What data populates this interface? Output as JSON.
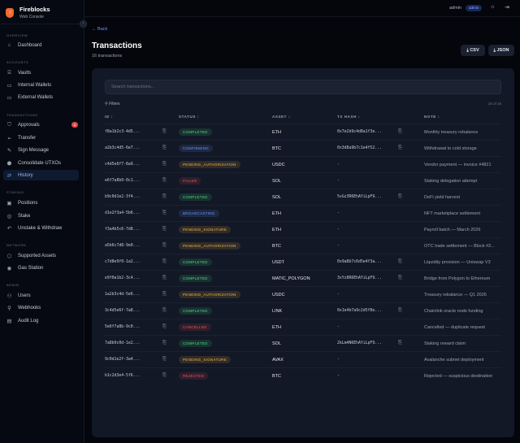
{
  "brand": {
    "name": "Fireblocks",
    "subtitle": "Web Console"
  },
  "sidebar": {
    "sections": [
      {
        "label": "OVERVIEW",
        "items": [
          {
            "label": "Dashboard",
            "icon": "home-icon"
          }
        ]
      },
      {
        "label": "ACCOUNTS",
        "items": [
          {
            "label": "Vaults",
            "icon": "bank-icon"
          },
          {
            "label": "Internal Wallets",
            "icon": "wallet-icon"
          },
          {
            "label": "External Wallets",
            "icon": "wallet-icon"
          }
        ]
      },
      {
        "label": "TRANSACTIONS",
        "items": [
          {
            "label": "Approvals",
            "icon": "shield-check-icon",
            "badge": "6"
          },
          {
            "label": "Transfer",
            "icon": "send-icon"
          },
          {
            "label": "Sign Message",
            "icon": "pen-icon"
          },
          {
            "label": "Consolidate UTXOs",
            "icon": "box-icon"
          },
          {
            "label": "History",
            "icon": "arrows-swap-icon",
            "active": true
          }
        ]
      },
      {
        "label": "STAKING",
        "items": [
          {
            "label": "Positions",
            "icon": "positions-icon"
          },
          {
            "label": "Stake",
            "icon": "target-icon"
          },
          {
            "label": "Unstake & Withdraw",
            "icon": "undo-icon"
          }
        ]
      },
      {
        "label": "NETWORK",
        "items": [
          {
            "label": "Supported Assets",
            "icon": "cube-icon"
          },
          {
            "label": "Gas Station",
            "icon": "gauge-icon"
          }
        ]
      },
      {
        "label": "ADMIN",
        "items": [
          {
            "label": "Users",
            "icon": "users-icon"
          },
          {
            "label": "Webhooks",
            "icon": "webhook-icon"
          },
          {
            "label": "Audit Log",
            "icon": "log-icon"
          }
        ]
      }
    ]
  },
  "topbar": {
    "user": "admin",
    "role": "admin"
  },
  "page": {
    "back": "← Back",
    "title": "Transactions",
    "subtitle": "16 transactions",
    "csv": "⤓ CSV",
    "json": "⤓ JSON"
  },
  "table": {
    "search_placeholder": "Search transactions...",
    "filters": "Filters",
    "count": "16 of 16",
    "headers": [
      "ID ↕",
      "STATUS ↕",
      "ASSET ↕",
      "TX HASH ↕",
      "NOTE ↕"
    ],
    "rows": [
      {
        "id": "f8a1b2c3-4d5...",
        "status": "COMPLETED",
        "asset": "ETH",
        "hash": "0x7e2b9c4d8a1f3e...",
        "note": "Monthly treasury rebalance"
      },
      {
        "id": "a2b3c4d5-6e7...",
        "status": "CONFIRMING",
        "asset": "BTC",
        "hash": "0x3d8a9b7c1e4f52...",
        "note": "Withdrawal to cold storage"
      },
      {
        "id": "c4d5e6f7-8a9...",
        "status": "PENDING_AUTHORIZATION",
        "asset": "USDC",
        "hash": "-",
        "note": "Vendor payment — invoice #4821"
      },
      {
        "id": "e6f7a8b9-0c1...",
        "status": "FAILED",
        "asset": "SOL",
        "hash": "-",
        "note": "Staking delegation attempt"
      },
      {
        "id": "b9c0d1e2-3f4...",
        "status": "COMPLETED",
        "asset": "SOL",
        "hash": "5vGz3R6EhAYiLpF9...",
        "note": "DeFi yield harvest"
      },
      {
        "id": "d1e2f3a4-5b6...",
        "status": "BROADCASTING",
        "asset": "ETH",
        "hash": "-",
        "note": "NFT marketplace settlement"
      },
      {
        "id": "f3a4b5c6-7d8...",
        "status": "PENDING_SIGNATURE",
        "asset": "ETH",
        "hash": "-",
        "note": "Payroll batch — March 2026"
      },
      {
        "id": "a5b6c7d8-9e0...",
        "status": "PENDING_AUTHORIZATION",
        "asset": "BTC",
        "hash": "-",
        "note": "OTC trade settlement — Block #2..."
      },
      {
        "id": "c7d8e9f0-1a2...",
        "status": "COMPLETED",
        "asset": "USDT",
        "hash": "0x9a8b7c6d5e4f3a...",
        "note": "Liquidity provision — Uniswap V3"
      },
      {
        "id": "e9f0a1b2-3c4...",
        "status": "COMPLETED",
        "asset": "MATIC_POLYGON",
        "hash": "3xYz8R6EhAYiLpF9...",
        "note": "Bridge from Polygon to Ethereum"
      },
      {
        "id": "1a2b3c4d-5e6...",
        "status": "PENDING_AUTHORIZATION",
        "asset": "USDC",
        "hash": "-",
        "note": "Treasury rebalance — Q1 2026"
      },
      {
        "id": "3c4d5e6f-7a8...",
        "status": "COMPLETED",
        "asset": "LINK",
        "hash": "0x1e4b7a9c2d5f8e...",
        "note": "Chainlink oracle node funding"
      },
      {
        "id": "5e6f7a8b-9c0...",
        "status": "CANCELLED",
        "asset": "ETH",
        "hash": "-",
        "note": "Cancelled — duplicate request"
      },
      {
        "id": "7a8b9c0d-1e2...",
        "status": "COMPLETED",
        "asset": "SOL",
        "hash": "2kLm4N6EhAYiLpF9...",
        "note": "Staking reward claim"
      },
      {
        "id": "9c0d1e2f-3a4...",
        "status": "PENDING_SIGNATURE",
        "asset": "AVAX",
        "hash": "-",
        "note": "Avalanche subnet deployment"
      },
      {
        "id": "b1c2d3e4-5f6...",
        "status": "REJECTED",
        "asset": "BTC",
        "hash": "-",
        "note": "Rejected — suspicious destination"
      }
    ]
  },
  "status_colors": {
    "COMPLETED": "#4ade80",
    "CONFIRMING": "#6f97ff",
    "BROADCASTING": "#6f97ff",
    "PENDING_AUTHORIZATION": "#f5b544",
    "PENDING_SIGNATURE": "#f5b544",
    "FAILED": "#f0565b",
    "CANCELLED": "#f0565b",
    "REJECTED": "#f0565b"
  }
}
